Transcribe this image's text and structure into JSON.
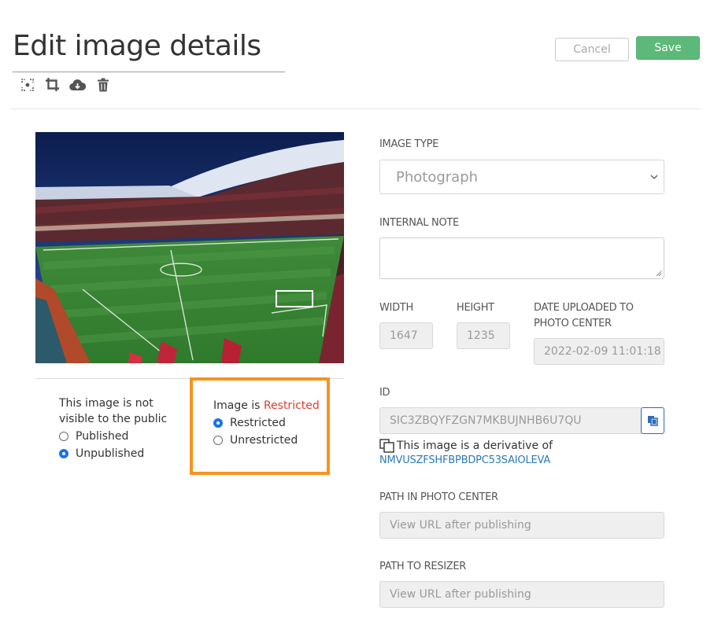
{
  "header": {
    "title": "Edit image details",
    "cancel_label": "Cancel",
    "save_label": "Save",
    "toolbar_icons": [
      "focal-point-icon",
      "crop-icon",
      "cloud-download-icon",
      "trash-icon"
    ]
  },
  "image": {
    "description": "Photograph"
  },
  "visibility": {
    "text": "This image is not visible to the public",
    "options": [
      {
        "label": "Published",
        "checked": false
      },
      {
        "label": "Unpublished",
        "checked": true
      }
    ]
  },
  "restriction": {
    "prefix": "Image is ",
    "status": "Restricted",
    "options": [
      {
        "label": "Restricted",
        "checked": true
      },
      {
        "label": "Unrestricted",
        "checked": false
      }
    ]
  },
  "form": {
    "image_type_label": "IMAGE TYPE",
    "image_type_value": "Photograph",
    "internal_note_label": "INTERNAL NOTE",
    "internal_note_value": "",
    "width_label": "WIDTH",
    "width_value": "1647",
    "height_label": "HEIGHT",
    "height_value": "1235",
    "date_label": "DATE UPLOADED TO PHOTO CENTER",
    "date_value": "2022-02-09 11:01:18",
    "id_label": "ID",
    "id_value": "SIC3ZBQYFZGN7MKBUJNHB6U7QU",
    "derivative_text": "This image is a derivative of",
    "derivative_link": "NMVUSZFSHFBPBDPC53SAIOLEVA",
    "path_photo_center_label": "PATH IN PHOTO CENTER",
    "path_photo_center_placeholder": "View URL after publishing",
    "path_resizer_label": "PATH TO RESIZER",
    "path_resizer_placeholder": "View URL after publishing"
  },
  "colors": {
    "save": "#5cb97a",
    "highlight_border": "#f7931e",
    "restricted_text": "#e23a2e",
    "link": "#2a7ab8",
    "radio_checked": "#1a73e8"
  }
}
